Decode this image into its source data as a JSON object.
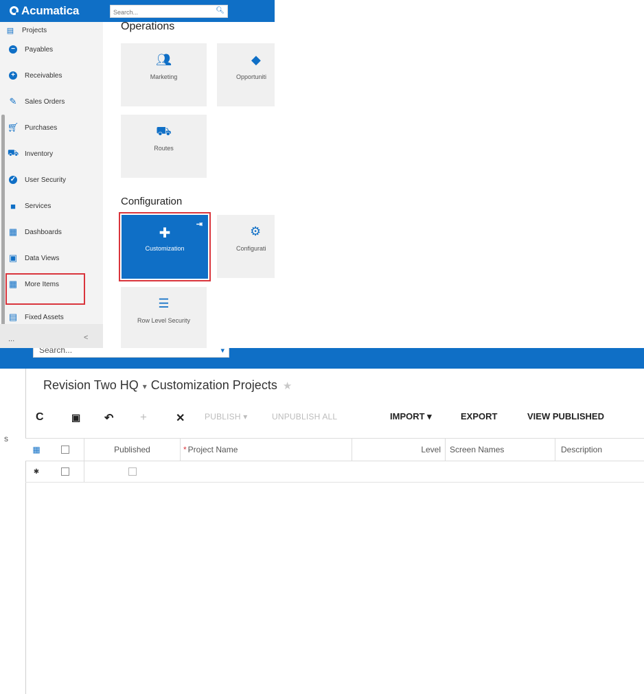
{
  "menu": {
    "logo_text": "Acumatica",
    "search_placeholder": "Search...",
    "sidebar": [
      {
        "label": "Projects",
        "icon": "projects-icon"
      },
      {
        "label": "Payables",
        "icon": "payables-icon"
      },
      {
        "label": "Receivables",
        "icon": "receivables-icon"
      },
      {
        "label": "Sales Orders",
        "icon": "sales-orders-icon"
      },
      {
        "label": "Purchases",
        "icon": "cart-icon"
      },
      {
        "label": "Inventory",
        "icon": "truck-icon"
      },
      {
        "label": "User Security",
        "icon": "shield-icon"
      },
      {
        "label": "Services",
        "icon": "briefcase-icon"
      },
      {
        "label": "Dashboards",
        "icon": "dashboard-icon"
      },
      {
        "label": "Data Views",
        "icon": "chart-icon"
      },
      {
        "label": "More Items",
        "icon": "grid-icon"
      },
      {
        "label": "Fixed Assets",
        "icon": "assets-icon"
      }
    ],
    "more": "...",
    "collapse": "<",
    "operations_title": "Operations",
    "configuration_title": "Configuration",
    "operations_tiles": [
      {
        "label": "Marketing",
        "icon": "people-icon"
      },
      {
        "label": "Opportuniti",
        "icon": "tag-icon"
      },
      {
        "label": "Routes",
        "icon": "truck-icon"
      }
    ],
    "configuration_tiles": [
      {
        "label": "Customization",
        "icon": "puzzle-icon",
        "active": true
      },
      {
        "label": "Configurati",
        "icon": "gear-icon"
      },
      {
        "label": "Row Level Security",
        "icon": "list-icon"
      }
    ],
    "accent": "#0f6fc6",
    "highlight": "#d9343b"
  },
  "page": {
    "search_text": "Search...",
    "rail_char": "s",
    "company": "Revision Two HQ",
    "screen": "Customization Projects",
    "toolbar": {
      "refresh": "C",
      "save": "💾",
      "undo": "↶",
      "add": "+",
      "delete": "✕",
      "publish": "PUBLISH ▾",
      "unpublish_all": "UNPUBLISH ALL",
      "import": "IMPORT ▾",
      "export": "EXPORT",
      "view_published": "VIEW PUBLISHED"
    },
    "columns": {
      "published": "Published",
      "project_name_required": "*",
      "project_name": "Project Name",
      "level": "Level",
      "screen_names": "Screen Names",
      "description": "Description"
    },
    "new_row_marker": "✱"
  }
}
